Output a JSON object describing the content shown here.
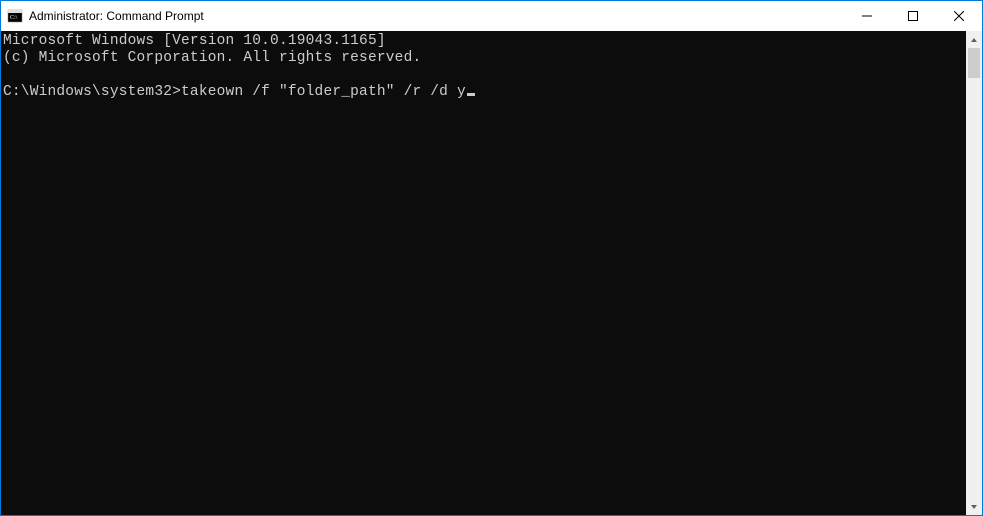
{
  "titlebar": {
    "title": "Administrator: Command Prompt"
  },
  "console": {
    "line1": "Microsoft Windows [Version 10.0.19043.1165]",
    "line2": "(c) Microsoft Corporation. All rights reserved.",
    "blank": "",
    "prompt": "C:\\Windows\\system32>",
    "command": "takeown /f \"folder_path\" /r /d y"
  }
}
